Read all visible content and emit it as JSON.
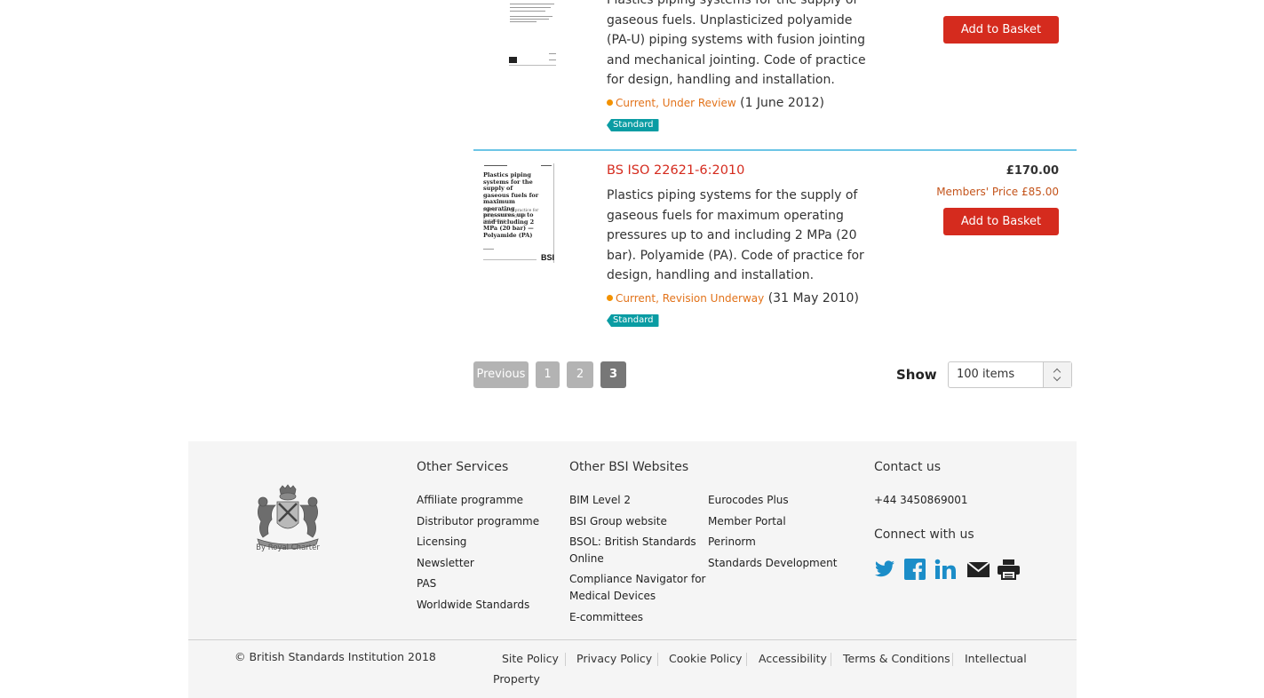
{
  "products": [
    {
      "description": "Plastics piping systems for the supply of gaseous fuels. Unplasticized polyamide (PA-U) piping systems with fusion jointing and mechanical jointing. Code of practice for design, handling and installation.",
      "status": "Current, Under Review",
      "date": "(1 June 2012)",
      "badge": "Standard",
      "basket_label": "Add to Basket"
    },
    {
      "code": "BS ISO 22621-6:2010",
      "description": "Plastics piping systems for the supply of gaseous fuels for maximum operating pressures up to and including 2 MPa (20 bar). Polyamide (PA). Code of practice for design, handling and installation.",
      "status": "Current, Revision Underway",
      "date": "(31 May 2010)",
      "badge": "Standard",
      "price": "£170.00",
      "members_price": "Members' Price £85.00",
      "basket_label": "Add to Basket",
      "cover_title": "Plastics piping systems for the supply of gaseous fuels for maximum operating pressures up to and including 2 MPa (20 bar) — Polyamide (PA)",
      "cover_subtitle": "Part 6: Code of practice for design, handling and installation",
      "cover_logo": "BSI"
    }
  ],
  "pagination": {
    "previous": "Previous",
    "pages": [
      "1",
      "2",
      "3"
    ],
    "current": "3",
    "show_label": "Show",
    "show_value": "100 items"
  },
  "footer": {
    "crest_caption": "By Royal Charter",
    "other_services": {
      "heading": "Other Services",
      "links": [
        "Affiliate programme",
        "Distributor programme",
        "Licensing",
        "Newsletter",
        "PAS",
        "Worldwide Standards"
      ]
    },
    "other_websites": {
      "heading": "Other BSI Websites",
      "col1": [
        "BIM Level 2",
        "BSI Group website",
        "BSOL: British Standards",
        "Online",
        "Compliance Navigator for",
        "Medical Devices",
        "E-committees"
      ],
      "col2": [
        "Eurocodes Plus",
        "Member Portal",
        "Perinorm",
        "Standards Development"
      ]
    },
    "contact": {
      "heading": "Contact us",
      "phone": "+44 3450869001",
      "connect": "Connect with us",
      "icons": [
        "twitter-icon",
        "facebook-icon",
        "linkedin-icon",
        "email-icon",
        "print-icon"
      ]
    },
    "copyright": "© British Standards Institution 2018",
    "policies": [
      "Site Policy",
      "Privacy Policy",
      "Cookie Policy",
      "Accessibility",
      "Terms & Conditions",
      "Intellectual",
      "Property"
    ]
  },
  "colors": {
    "accent_red": "#d52b1e",
    "status_orange": "#e2731b",
    "badge_teal": "#0a9ca3",
    "divider_blue": "#6cc5e6",
    "social_blue": "#1b8dc8",
    "footer_bg": "#f5f5f5"
  }
}
